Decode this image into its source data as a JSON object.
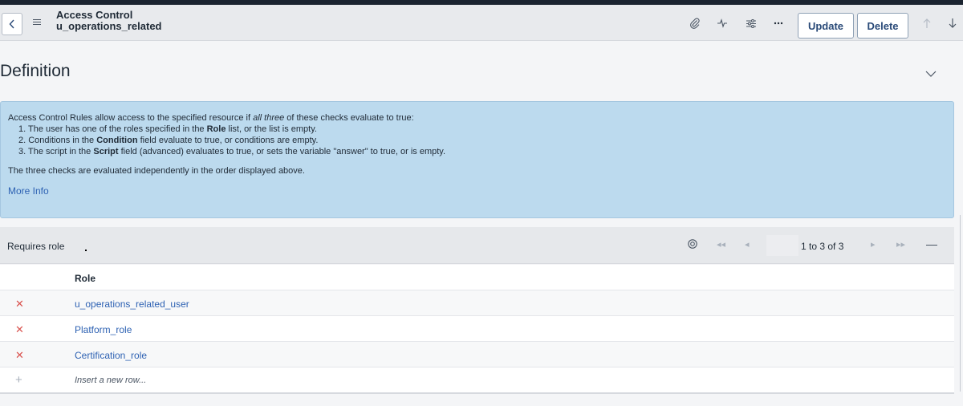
{
  "header": {
    "title": "Access Control",
    "subtitle": "u_operations_related",
    "update_label": "Update",
    "delete_label": "Delete",
    "icons": [
      "back-icon",
      "menu-icon",
      "paperclip-icon",
      "activity-icon",
      "settings-sliders-icon",
      "more-icon",
      "arrow-up-icon",
      "arrow-down-icon"
    ]
  },
  "section": {
    "title": "Definition"
  },
  "info": {
    "intro_before": "Access Control Rules allow access to the specified resource if ",
    "intro_em": "all three",
    "intro_after": " of these checks evaluate to true:",
    "item1_before": "1. The user has one of the roles specified in the ",
    "item1_bold": "Role",
    "item1_after": " list, or the list is empty.",
    "item2_before": "2. Conditions in the ",
    "item2_bold": "Condition",
    "item2_after": " field evaluate to true, or conditions are empty.",
    "item3_before": "3. The script in the ",
    "item3_bold": "Script",
    "item3_after": " field (advanced) evaluates to true, or sets the variable \"answer\" to true, or is empty.",
    "note": "The three checks are evaluated independently in the order displayed above.",
    "more_info": "More Info"
  },
  "related_list": {
    "title": "Requires role",
    "pager_text": "1  to 3 of 3",
    "column_header": "Role",
    "rows": [
      {
        "role": "u_operations_related_user"
      },
      {
        "role": "Platform_role"
      },
      {
        "role": "Certification_role"
      }
    ],
    "insert_row": "Insert a new row..."
  },
  "colors": {
    "info_bg": "#bcdaee",
    "link": "#2e62b3",
    "delete_x": "#d9534f"
  }
}
